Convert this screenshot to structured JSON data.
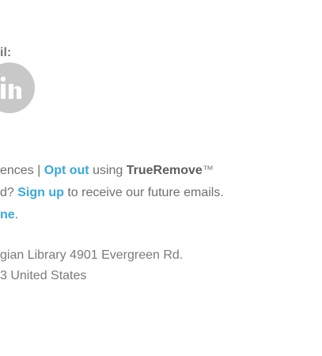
{
  "share_heading": "il:",
  "prefs": {
    "prefix": "ences | ",
    "opt_out": "Opt out",
    "middle": " using ",
    "brand": "TrueRemove",
    "tm": "™"
  },
  "signup": {
    "prefix": "d? ",
    "link": "Sign up",
    "suffix": " to receive our future emails."
  },
  "extra": {
    "link": "ne",
    "suffix": "."
  },
  "address": {
    "line1": "gian Library 4901 Evergreen Rd.",
    "line2": "3 United States"
  },
  "icons": {
    "social": "linkedin-icon"
  },
  "colors": {
    "link": "#39a9dc",
    "text": "#6f6f6f",
    "icon_bg": "#c8c8c8"
  }
}
